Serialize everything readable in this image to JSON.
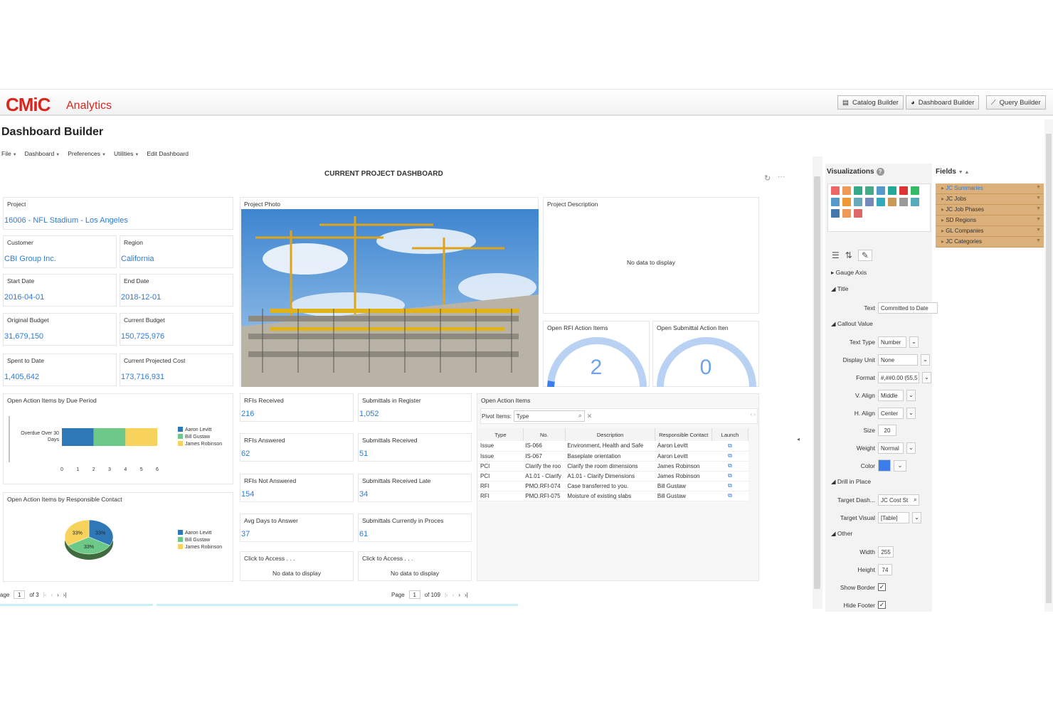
{
  "header": {
    "logo": "CMiC",
    "app_name": "Analytics",
    "buttons": [
      "Catalog Builder",
      "Dashboard Builder",
      "Query Builder"
    ]
  },
  "page_title": "Dashboard Builder",
  "menu": [
    "File",
    "Dashboard",
    "Preferences",
    "Utilities",
    "Edit Dashboard"
  ],
  "dashboard_title": "CURRENT PROJECT DASHBOARD",
  "info": {
    "project_label": "Project",
    "project_value": "16006 - NFL Stadium - Los Angeles",
    "customer_label": "Customer",
    "customer_value": "CBI Group Inc.",
    "region_label": "Region",
    "region_value": "California",
    "start_label": "Start Date",
    "start_value": "2016-04-01",
    "end_label": "End Date",
    "end_value": "2018-12-01",
    "orig_budget_label": "Original Budget",
    "orig_budget_value": "31,679,150",
    "cur_budget_label": "Current Budget",
    "cur_budget_value": "150,725,976",
    "spent_label": "Spent to Date",
    "spent_value": "1,405,642",
    "proj_cost_label": "Current Projected Cost",
    "proj_cost_value": "173,716,931"
  },
  "photo_label": "Project Photo",
  "description": {
    "label": "Project Description",
    "empty": "No data to display"
  },
  "gauges": [
    {
      "label": "Open RFI Action Items",
      "value": "2"
    },
    {
      "label": "Open Submittal Action Iten",
      "value": "0"
    }
  ],
  "bar_chart_title": "Open Action Items by Due Period",
  "pie_chart_title": "Open Action Items by Responsible Contact",
  "chart_data": [
    {
      "type": "bar",
      "title": "Open Action Items by Due Period",
      "categories": [
        "Overdue Over 30 Days"
      ],
      "series": [
        {
          "name": "Aaron Levitt",
          "values": [
            2
          ],
          "color": "#2e78b7"
        },
        {
          "name": "Bill Gustaw",
          "values": [
            2
          ],
          "color": "#6cc987"
        },
        {
          "name": "James Robinson",
          "values": [
            2
          ],
          "color": "#f7d35b"
        }
      ],
      "xlim": [
        0,
        6
      ],
      "x_ticks": [
        "0",
        "1",
        "2",
        "3",
        "4",
        "5",
        "6"
      ],
      "orientation": "horizontal",
      "stacked": true,
      "legend": "right"
    },
    {
      "type": "pie",
      "title": "Open Action Items by Responsible Contact",
      "slices": [
        {
          "name": "Aaron Levitt",
          "value": 33,
          "label": "33%",
          "color": "#2e78b7"
        },
        {
          "name": "Bill Gustaw",
          "value": 33,
          "label": "33%",
          "color": "#6cc987"
        },
        {
          "name": "James Robinson",
          "value": 33,
          "label": "33%",
          "color": "#f7d35b"
        }
      ],
      "legend": "right"
    }
  ],
  "rfi": [
    {
      "label": "RFIs Received",
      "value": "216"
    },
    {
      "label": "RFIs Answered",
      "value": "62"
    },
    {
      "label": "RFIs Not Answered",
      "value": "154"
    },
    {
      "label": "Avg Days to Answer",
      "value": "37"
    },
    {
      "label": "Click to Access . . .",
      "empty": "No data to display"
    }
  ],
  "submittals": [
    {
      "label": "Submittals in Register",
      "value": "1,052"
    },
    {
      "label": "Submittals Received",
      "value": "51"
    },
    {
      "label": "Submittals Received Late",
      "value": "34"
    },
    {
      "label": "Submittals Currently in Proces",
      "value": "61"
    },
    {
      "label": "Click to Access . . .",
      "empty": "No data to display"
    }
  ],
  "open_action_items": {
    "label": "Open Action Items",
    "pivot_label": "Pivot Items:",
    "pivot_value": "Type",
    "columns": [
      "Type",
      "No.",
      "Description",
      "Responsible Contact",
      "Launch"
    ],
    "rows": [
      [
        "Issue",
        "IS-066",
        "Environment, Health and Safe",
        "Aaron Levitt"
      ],
      [
        "Issue",
        "IS-067",
        "Baseplate orientation",
        "Aaron Levitt"
      ],
      [
        "PCI",
        "Clarify the roo",
        "Clarify the room dimensions",
        "James Robinson"
      ],
      [
        "PCI",
        "A1.01 - Clarify",
        "A1.01 - Clarify Dimensions",
        "James Robinson"
      ],
      [
        "RFI",
        "PMO.RFI-074",
        "Case transferred to you.",
        "Bill Gustaw"
      ],
      [
        "RFI",
        "PMO.RFI-075",
        "Moisture of existing slabs",
        "Bill Gustaw"
      ]
    ]
  },
  "pager_left": {
    "label": "age",
    "page": "1",
    "of": "of 3"
  },
  "pager_right": {
    "label": "Page",
    "page": "1",
    "of": "of 109"
  },
  "sidebar": {
    "viz_title": "Visualizations",
    "fields_title": "Fields",
    "fields": [
      "JC Summaries",
      "JC Jobs",
      "JC Job Phases",
      "SD Regions",
      "GL Companies",
      "JC Categories"
    ],
    "sections": {
      "gauge_axis": "Gauge Axis",
      "title": "Title",
      "callout": "Callout Value",
      "drill": "Drill in Place",
      "other": "Other"
    },
    "props": {
      "text_label": "Text",
      "text_value": "Committed to Date",
      "text_type_label": "Text Type",
      "text_type_value": "Number",
      "display_unit_label": "Display Unit",
      "display_unit_value": "None",
      "format_label": "Format",
      "format_value": "#,##0.00 (55,5",
      "valign_label": "V. Align",
      "valign_value": "Middle",
      "halign_label": "H. Align",
      "halign_value": "Center",
      "size_label": "Size",
      "size_value": "20",
      "weight_label": "Weight",
      "weight_value": "Normal",
      "color_label": "Color",
      "color_value": "#3b7ded",
      "target_dash_label": "Target Dash...",
      "target_dash_value": "JC Cost St",
      "target_visual_label": "Target Visual",
      "target_visual_value": "[Table]",
      "width_label": "Width",
      "width_value": "255",
      "height_label": "Height",
      "height_value": "74",
      "show_border_label": "Show Border",
      "hide_footer_label": "Hide Footer"
    }
  }
}
